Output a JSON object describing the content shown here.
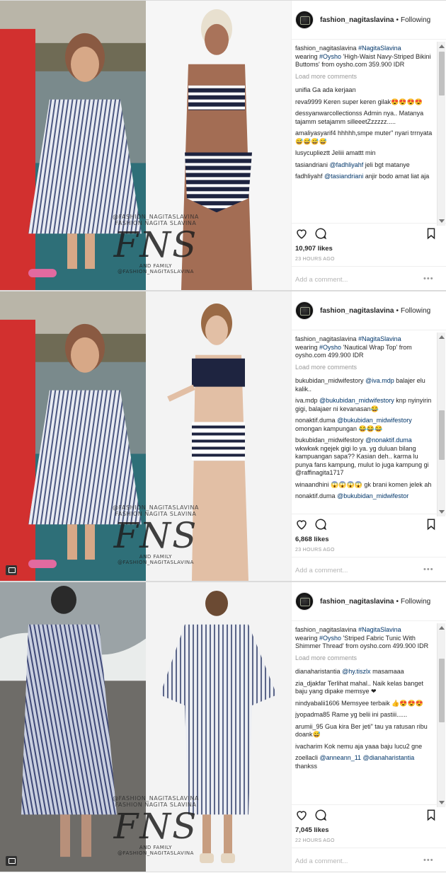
{
  "posts": [
    {
      "username": "fashion_nagitaslavina",
      "follow_label": "Following",
      "caption_user": "fashion_nagitaslavina",
      "caption_tag": "#NagitaSlavina",
      "caption_mid": "wearing",
      "caption_brand": "#Oysho",
      "caption_rest": "'High-Waist Navy-Striped Bikini Buttoms' from oysho.com 359.900 IDR",
      "load_more": "Load more comments",
      "comments": [
        {
          "user": "unifia",
          "mention": "",
          "text": "Ga ada kerjaan"
        },
        {
          "user": "reva9999",
          "mention": "",
          "text": "Keren super keren gilak😍😍😍😍"
        },
        {
          "user": "dessyanwarcollectionss",
          "mention": "",
          "text": "Admin nya.. Matanya tajamm setajamm silleeetZzzzzz....."
        },
        {
          "user": "amaliyasyarif4",
          "mention": "",
          "text": "hhhhh,smpe muter\" nyari trrnyata 😅😅😅😅"
        },
        {
          "user": "lusycuplieztt",
          "mention": "",
          "text": "Jeliii amattt min"
        },
        {
          "user": "tasiandriani",
          "mention": "@fadhliyahf",
          "text": "jeli bgt matanye"
        },
        {
          "user": "fadhliyahf",
          "mention": "@tasiandriani",
          "text": "anjir bodo amat liat aja"
        }
      ],
      "likes": "10,907 likes",
      "time": "23 HOURS AGO",
      "add_comment_placeholder": "Add a comment...",
      "more": "•••",
      "watermark_top": "@FASHION_NAGITASLAVINA",
      "watermark_sub": "FASHION NAGITA SLAVINA",
      "watermark_logo": "FNS",
      "watermark_bottom": "AND FAMILY",
      "watermark_handle2": "@FASHION_NAGITASLAVINA"
    },
    {
      "username": "fashion_nagitaslavina",
      "follow_label": "Following",
      "caption_user": "fashion_nagitaslavina",
      "caption_tag": "#NagitaSlavina",
      "caption_mid": "wearing",
      "caption_brand": "#Oysho",
      "caption_rest": "'Nautical Wrap Top' from oysho.com 499.900 IDR",
      "load_more": "Load more comments",
      "comments": [
        {
          "user": "bukubidan_midwifestory",
          "mention": "@iva.mdp",
          "text": "balajer elu kalik.."
        },
        {
          "user": "iva.mdp",
          "mention": "@bukubidan_midwifestory",
          "text": "knp nyinyirin gigi, balajaer ni kevanasan😂"
        },
        {
          "user": "nonaktif.duma",
          "mention": "@bukubidan_midwifestory",
          "text": "omongan kampungan 😂😂😂"
        },
        {
          "user": "bukubidan_midwifestory",
          "mention": "@nonaktif.duma",
          "text": "wkwkwk ngejek gigi lo ya. yg duluan bilang kampuangan sapa?? Kasian deh.. karma lu punya fans kampung, mulut lo juga kampung gi @raffinagita1717"
        },
        {
          "user": "winaandhini",
          "mention": "",
          "text": "😱😱😱😱 gk brani komen jelek ah"
        },
        {
          "user": "nonaktif.duma",
          "mention": "@bukubidan_midwifestor",
          "text": ""
        }
      ],
      "likes": "6,868 likes",
      "time": "23 HOURS AGO",
      "add_comment_placeholder": "Add a comment...",
      "more": "•••",
      "watermark_top": "@FASHION_NAGITASLAVINA",
      "watermark_sub": "FASHION NAGITA SLAVINA",
      "watermark_logo": "FNS",
      "watermark_bottom": "AND FAMILY",
      "watermark_handle2": "@FASHION_NAGITASLAVINA"
    },
    {
      "username": "fashion_nagitaslavina",
      "follow_label": "Following",
      "caption_user": "fashion_nagitaslavina",
      "caption_tag": "#NagitaSlavina",
      "caption_mid": "wearing",
      "caption_brand": "#Oysho",
      "caption_rest": "'Striped Fabric Tunic With Shimmer Thread' from oysho.com 499.900 IDR",
      "load_more": "Load more comments",
      "comments": [
        {
          "user": "dianaharistantia",
          "mention": "@hy.tiszlx",
          "text": "masamaaa"
        },
        {
          "user": "zia_djakfar",
          "mention": "",
          "text": "Terlihat mahal.. Naik kelas banget baju yang dipake memsye ❤"
        },
        {
          "user": "nindyabalii1606",
          "mention": "",
          "text": "Memsyee terbaik 👍😍😍😍"
        },
        {
          "user": "jyopadma85",
          "mention": "",
          "text": "Rame yg belii ini pastiii......"
        },
        {
          "user": "arumii_95",
          "mention": "",
          "text": "Gua kira Ber jeti\" tau ya ratusan ribu doank😅"
        },
        {
          "user": "ivacharim",
          "mention": "",
          "text": "Kok nemu aja yaaa baju lucu2 gne"
        },
        {
          "user": "zoellacli",
          "mention": "@anneann_11 @dianaharistantia",
          "text": "thankss"
        }
      ],
      "likes": "7,045 likes",
      "time": "22 HOURS AGO",
      "add_comment_placeholder": "Add a comment...",
      "more": "•••",
      "watermark_top": "@FASHION_NAGITASLAVINA",
      "watermark_sub": "FASHION NAGITA SLAVINA",
      "watermark_logo": "FNS",
      "watermark_bottom": "AND FAMILY",
      "watermark_handle2": "@FASHION_NAGITASLAVINA"
    }
  ],
  "icons": {
    "like": "heart-icon",
    "comment": "comment-icon",
    "save": "bookmark-icon",
    "carousel": "carousel-icon"
  }
}
